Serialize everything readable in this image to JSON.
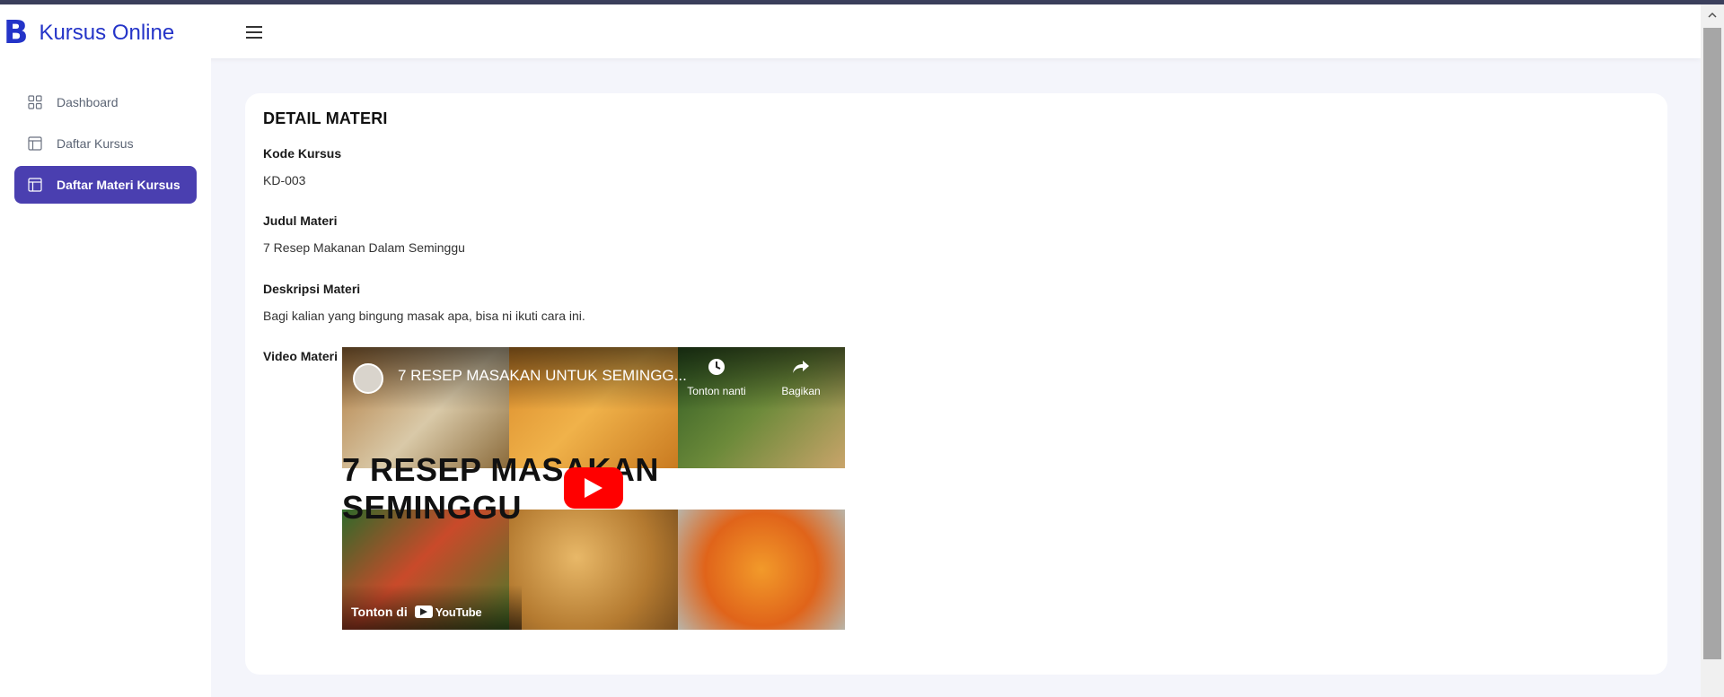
{
  "navbar": {
    "brand_logo": "B",
    "brand_name": "Kursus Online"
  },
  "sidebar": {
    "items": [
      {
        "label": "Dashboard",
        "icon": "grid-icon",
        "active": false
      },
      {
        "label": "Daftar Kursus",
        "icon": "layout-icon",
        "active": false
      },
      {
        "label": "Daftar Materi Kursus",
        "icon": "layout-icon",
        "active": true
      }
    ]
  },
  "detail": {
    "title": "DETAIL MATERI",
    "fields": [
      {
        "label": "Kode Kursus",
        "value": "KD-003"
      },
      {
        "label": "Judul Materi",
        "value": "7 Resep Makanan Dalam Seminggu"
      },
      {
        "label": "Deskripsi Materi",
        "value": "Bagi kalian yang bingung masak apa, bisa ni ikuti cara ini."
      }
    ],
    "video_label": "Video Materi"
  },
  "video": {
    "title": "7 RESEP MASAKAN UNTUK SEMINGG...",
    "banner_text": "7 RESEP MASAKAN SEMINGGU",
    "watch_later": "Tonton nanti",
    "share": "Bagikan",
    "watch_on": "Tonton di",
    "platform": "YouTube",
    "play_color": "#ff0000"
  },
  "colors": {
    "brand": "#2434c8",
    "active_nav": "#4a3fb0",
    "background": "#f4f5fb"
  }
}
